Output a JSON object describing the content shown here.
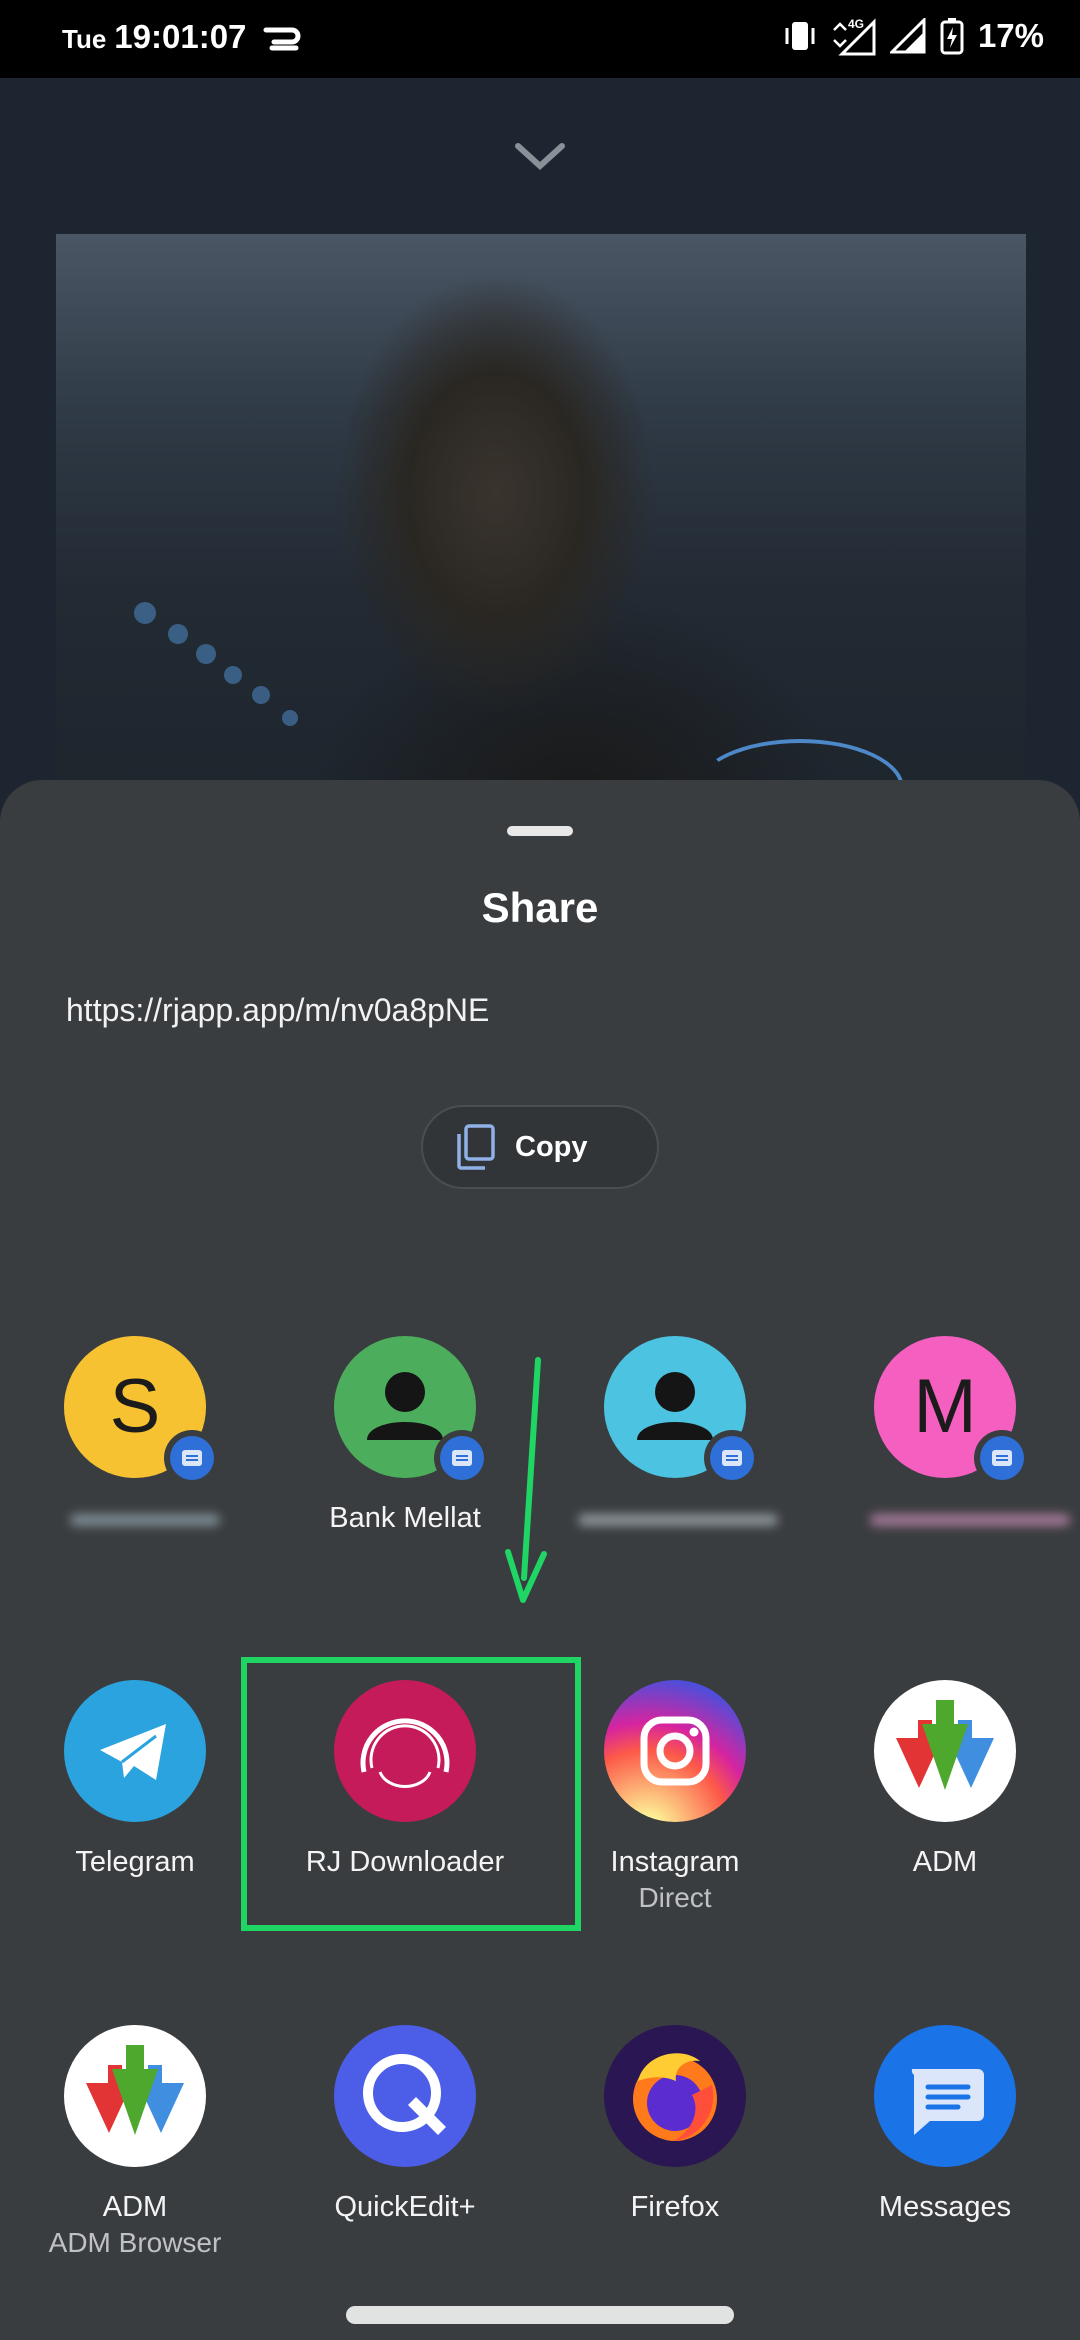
{
  "status_bar": {
    "day": "Tue",
    "time": "19:01:07",
    "battery": "17%",
    "network": "4G"
  },
  "sheet": {
    "title": "Share",
    "url": "https://rjapp.app/m/nv0a8pNE",
    "copy_label": "Copy"
  },
  "contacts": [
    {
      "initial": "S",
      "label": "",
      "color": "#f6c232"
    },
    {
      "initial": "",
      "label": "Bank Mellat",
      "color": "#4cae5c"
    },
    {
      "initial": "",
      "label": "",
      "color": "#4cc3e1"
    },
    {
      "initial": "M",
      "label": "",
      "color": "#f55fc0"
    }
  ],
  "apps_row1": [
    {
      "label": "Telegram",
      "sublabel": "",
      "icon": "telegram-icon"
    },
    {
      "label": "RJ Downloader",
      "sublabel": "",
      "icon": "rj-downloader-icon"
    },
    {
      "label": "Instagram",
      "sublabel": "Direct",
      "icon": "instagram-icon"
    },
    {
      "label": "ADM",
      "sublabel": "",
      "icon": "adm-icon"
    }
  ],
  "apps_row2": [
    {
      "label": "ADM",
      "sublabel": "ADM Browser",
      "icon": "adm-icon"
    },
    {
      "label": "QuickEdit+",
      "sublabel": "",
      "icon": "quickedit-icon"
    },
    {
      "label": "Firefox",
      "sublabel": "",
      "icon": "firefox-icon"
    },
    {
      "label": "Messages",
      "sublabel": "",
      "icon": "messages-icon"
    }
  ],
  "colors": {
    "sheet_bg": "#3a3d40",
    "highlight": "#1fd665",
    "message_badge": "#2f6fd8"
  }
}
